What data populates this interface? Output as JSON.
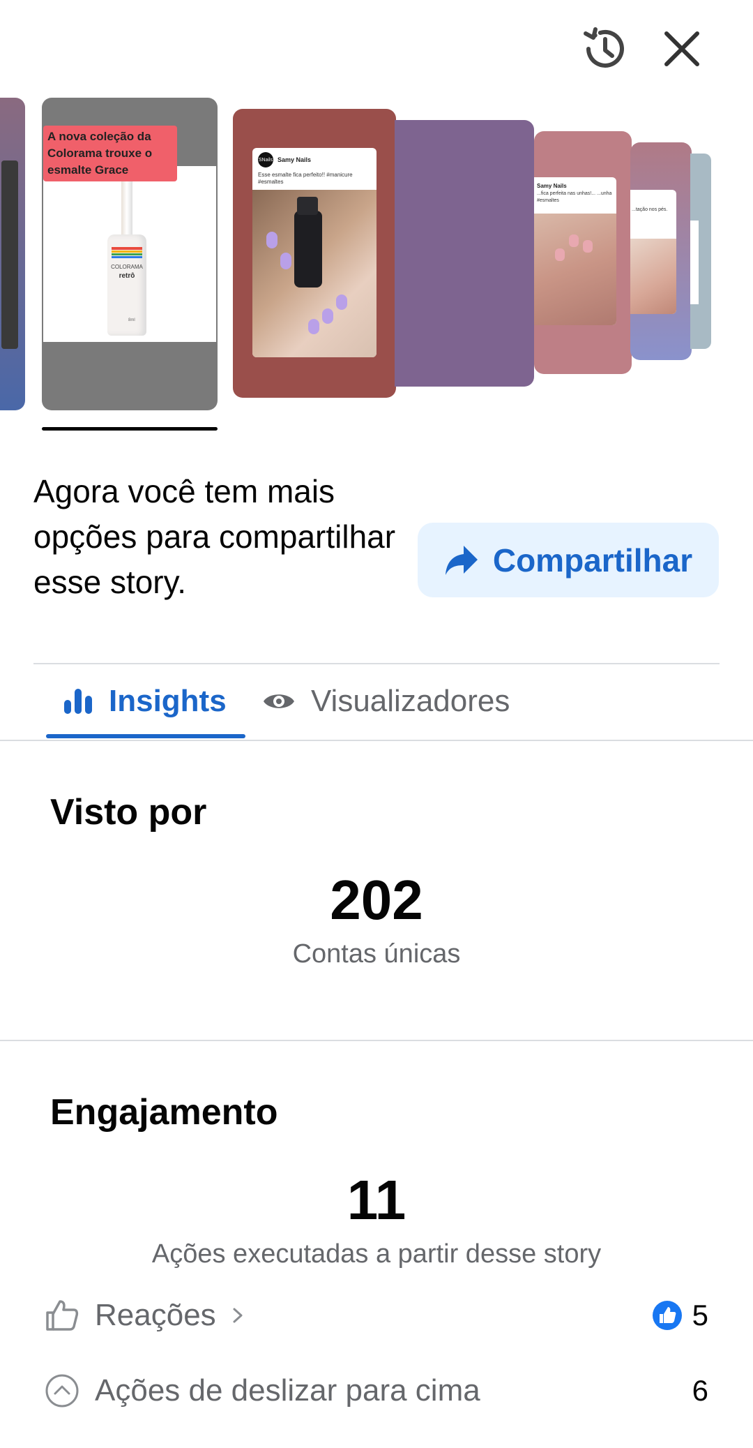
{
  "header": {
    "history_icon": "history-icon",
    "close_icon": "close-icon"
  },
  "stories": {
    "selected_card": {
      "banner_text": "A nova coleção da Colorama trouxe o esmalte Grace",
      "bottle_brand": "COLORAMA",
      "bottle_line": "retrô",
      "bottle_volume": "8ml"
    },
    "post_card_1": {
      "account": "Samy Nails",
      "avatar_text": "SNails",
      "caption": "Esse esmalte fica perfeito!! #manicure #esmaltes"
    },
    "post_card_2": {
      "account": "Samy Nails",
      "caption": "...fica perfeita nas unhas!... ...unha #esmaltes"
    },
    "post_card_3": {
      "caption": "...tação nos pés."
    },
    "colors": {
      "bg_selected": "#7a7a7a",
      "card_1_bg": "#9a4f4b",
      "card_2_bg": "#7e6490",
      "card_3_bg": "#be7f86",
      "card_4_bg": "#8c8ec4",
      "card_5_bg": "#a8bac4",
      "banner_bg": "#f0606a"
    }
  },
  "share": {
    "text": "Agora você tem mais opções para compartilhar esse story.",
    "button_label": "Compartilhar",
    "icon": "share-arrow-icon"
  },
  "tabs": [
    {
      "label": "Insights",
      "icon": "bar-chart-icon",
      "active": true
    },
    {
      "label": "Visualizadores",
      "icon": "eye-icon",
      "active": false
    }
  ],
  "reach": {
    "title": "Visto por",
    "value": "202",
    "caption": "Contas únicas"
  },
  "engagement": {
    "title": "Engajamento",
    "value": "11",
    "caption": "Ações executadas a partir desse story",
    "rows": [
      {
        "label": "Reações",
        "icon": "thumbs-up-outline-icon",
        "value": "5",
        "value_icon": "like-badge-icon",
        "chevron": "chevron-right-icon"
      },
      {
        "label": "Ações de deslizar para cima",
        "icon": "swipe-up-icon",
        "value": "6"
      }
    ]
  },
  "theme": {
    "accent": "#1b66c9",
    "accent_light": "#e7f3ff",
    "secondary_text": "#65676b",
    "divider": "#dadde1"
  }
}
